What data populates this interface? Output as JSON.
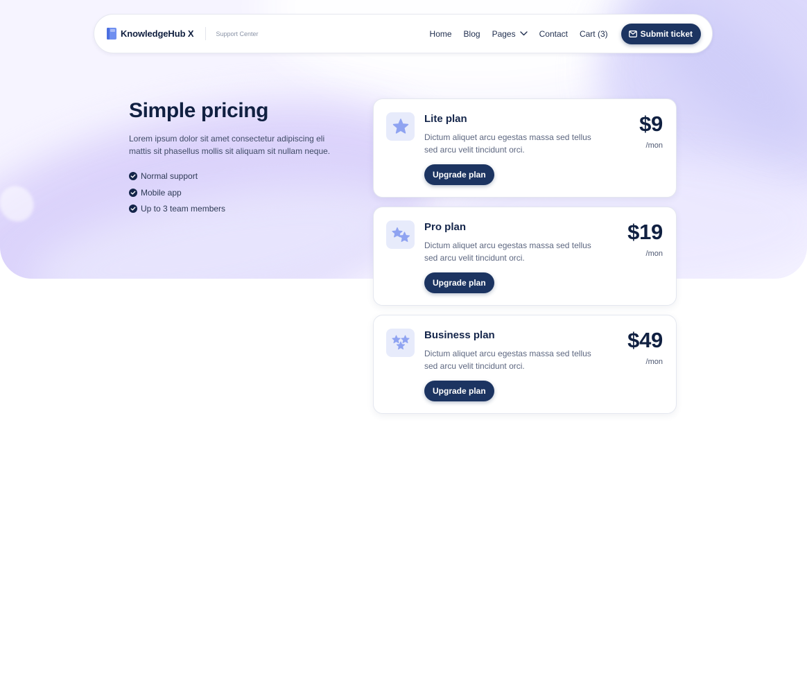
{
  "navbar": {
    "brand_name": "KnowledgeHub X",
    "brand_subtitle": "Support Center",
    "links": [
      "Home",
      "Blog",
      "Pages",
      "Contact",
      "Cart (3)"
    ],
    "cta_label": "Submit ticket"
  },
  "intro": {
    "title": "Simple pricing",
    "description": "Lorem ipsum dolor sit amet consectetur adipiscing eli mattis sit phasellus mollis sit aliquam sit nullam neque.",
    "features": [
      "Normal support",
      "Mobile app",
      "Up to 3 team members"
    ]
  },
  "plans": [
    {
      "name": "Lite plan",
      "description": "Dictum aliquet arcu egestas massa sed tellus sed arcu velit tincidunt orci.",
      "price": "$9",
      "period": "/mon",
      "button_label": "Upgrade plan",
      "icon": "single-star-icon"
    },
    {
      "name": "Pro plan",
      "description": "Dictum aliquet arcu egestas massa sed tellus sed arcu velit tincidunt orci.",
      "price": "$19",
      "period": "/mon",
      "button_label": "Upgrade plan",
      "icon": "two-stars-icon"
    },
    {
      "name": "Business plan",
      "description": "Dictum aliquet arcu egestas massa sed tellus sed arcu velit tincidunt orci.",
      "price": "$49",
      "period": "/mon",
      "button_label": "Upgrade plan",
      "icon": "three-stars-icon"
    }
  ],
  "colors": {
    "primary": "#1c3461",
    "heading": "#102041",
    "icon_star": "#8fa3f1",
    "icon_bg": "#e7ebfb",
    "hero_tint": "#d9d0fb"
  }
}
